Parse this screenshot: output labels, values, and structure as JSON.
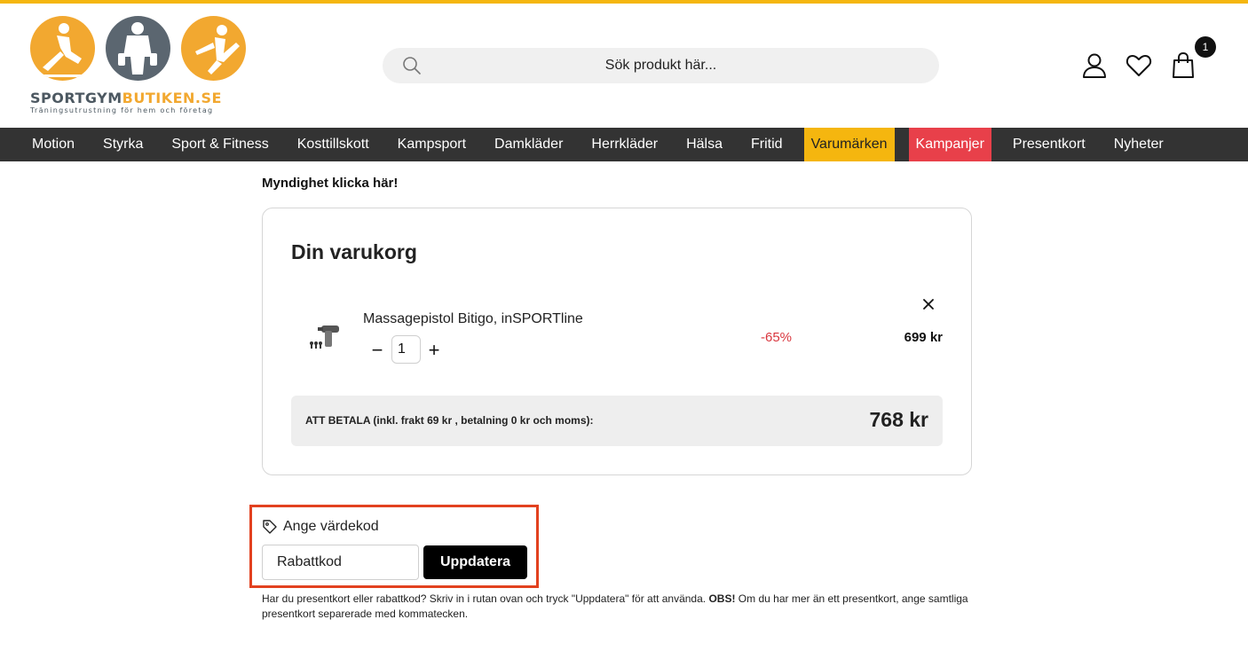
{
  "brand": {
    "name_part1": "SPORTGYM",
    "name_part2": "BUTIKEN.SE",
    "tagline": "Träningsutrustning för hem och företag"
  },
  "search": {
    "placeholder": "Sök produkt här..."
  },
  "header": {
    "cart_count": "1"
  },
  "nav": {
    "items": [
      {
        "label": "Motion"
      },
      {
        "label": "Styrka"
      },
      {
        "label": "Sport & Fitness"
      },
      {
        "label": "Kosttillskott"
      },
      {
        "label": "Kampsport"
      },
      {
        "label": "Damkläder"
      },
      {
        "label": "Herrkläder"
      },
      {
        "label": "Hälsa"
      },
      {
        "label": "Fritid"
      },
      {
        "label": "Varumärken"
      },
      {
        "label": "Kampanjer"
      },
      {
        "label": "Presentkort"
      },
      {
        "label": "Nyheter"
      }
    ]
  },
  "authority_link": "Myndighet klicka här!",
  "cart": {
    "title": "Din varukorg",
    "item": {
      "name": "Massagepistol Bitigo, inSPORTline",
      "quantity": "1",
      "discount": "-65%",
      "price": "699 kr"
    },
    "total_label": "ATT BETALA (inkl. frakt 69 kr , betalning 0 kr och moms):",
    "total_amount": "768 kr"
  },
  "voucher": {
    "label": "Ange värdekod",
    "placeholder": "Rabattkod",
    "button": "Uppdatera",
    "help_text_1": "Har du presentkort eller rabattkod? Skriv in i rutan ovan och tryck \"Uppdatera\" för att använda.",
    "help_bold": "OBS!",
    "help_text_2": "Om du har mer än ett presentkort, ange samtliga presentkort separerade med kommatecken."
  },
  "colors": {
    "accent_yellow": "#f5b60f",
    "nav_bg": "#333333",
    "campaign_red": "#e8404a",
    "discount_red": "#d9363e",
    "highlight_orange": "#e2411f"
  }
}
